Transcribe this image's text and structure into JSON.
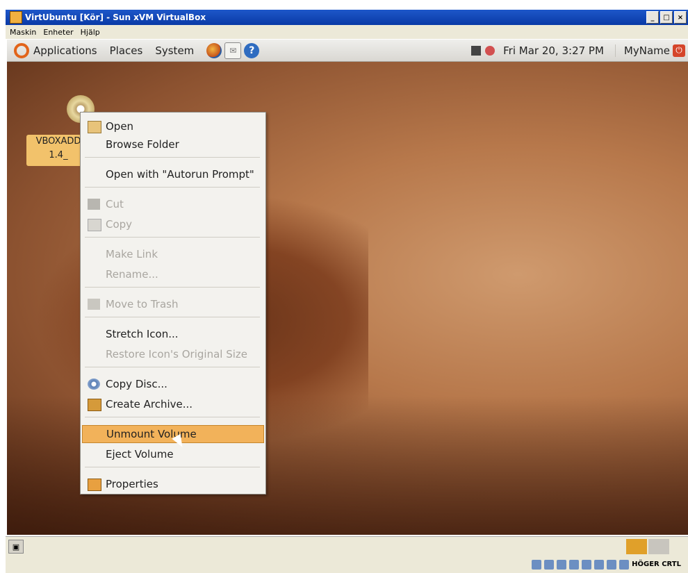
{
  "window": {
    "title": "VirtUbuntu [Kör] - Sun xVM VirtualBox",
    "buttons": [
      "_",
      "□",
      "×"
    ]
  },
  "host_menu": [
    "Maskin",
    "Enheter",
    "Hjälp"
  ],
  "panel": {
    "menus": [
      "Applications",
      "Places",
      "System"
    ],
    "clock": "Fri Mar 20,  3:27 PM",
    "user": "MyName"
  },
  "desktop_icon": {
    "label_line1": "VBOXADD",
    "label_line2": "1.4_"
  },
  "context_menu": {
    "items": [
      {
        "label": "Open",
        "icon": "open-icon",
        "enabled": true
      },
      {
        "label": "Browse Folder",
        "enabled": true
      },
      {
        "label": "Open with \"Autorun Prompt\"",
        "enabled": true
      },
      {
        "label": "Cut",
        "icon": "cut-icon",
        "enabled": false
      },
      {
        "label": "Copy",
        "icon": "copy-icon",
        "enabled": false
      },
      {
        "label": "Make Link",
        "enabled": false
      },
      {
        "label": "Rename...",
        "enabled": false
      },
      {
        "label": "Move to Trash",
        "icon": "trash-icon",
        "enabled": false
      },
      {
        "label": "Stretch Icon...",
        "enabled": true
      },
      {
        "label": "Restore Icon's Original Size",
        "enabled": false
      },
      {
        "label": "Copy Disc...",
        "icon": "disc-icon",
        "enabled": true
      },
      {
        "label": "Create Archive...",
        "icon": "archive-icon",
        "enabled": true
      },
      {
        "label": "Unmount Volume",
        "enabled": true,
        "highlighted": true
      },
      {
        "label": "Eject Volume",
        "enabled": true
      },
      {
        "label": "Properties",
        "icon": "properties-icon",
        "enabled": true
      }
    ]
  },
  "status_bar": {
    "host_key": "HÖGER CRTL"
  }
}
